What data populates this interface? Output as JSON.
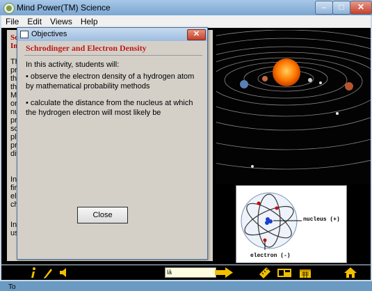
{
  "window": {
    "title": "Mind Power(TM) Science"
  },
  "menu": [
    "File",
    "Edit",
    "Views",
    "Help"
  ],
  "colors": {
    "title_red": "#c01a1a",
    "icon_yellow": "#f0c000"
  },
  "bg_text": {
    "heading_line1": "Sc",
    "heading_line2": "In",
    "paragraph_start_letters": [
      "Th",
      "pr",
      "the",
      "the",
      "Mi",
      "or",
      "nu",
      "pr",
      "sc",
      "pl",
      "pr",
      "dif"
    ],
    "para2_letters": [
      "In",
      "firs",
      "ele",
      "ch"
    ],
    "para3_letters": [
      "In",
      "us"
    ],
    "status": "To"
  },
  "dialog": {
    "title": "Objectives",
    "heading": "Schrodinger and Electron Density",
    "intro": "In this activity, students will:",
    "bullet1": "• observe the electron density of a hydrogen atom by mathematical probability methods",
    "bullet2": "• calculate the distance from the nucleus at which the hydrogen electron will most likely be",
    "close_button": "Close"
  },
  "atom": {
    "nucleus_label": "nucleus (+)",
    "electron_label": "electron (-)"
  },
  "toolbar": {
    "input_value": "lā"
  },
  "icons": [
    "info-icon",
    "pencil-icon",
    "speaker-icon",
    "arrow-right-icon",
    "ruler-icon",
    "glossary-icon",
    "calendar-icon",
    "home-icon"
  ]
}
